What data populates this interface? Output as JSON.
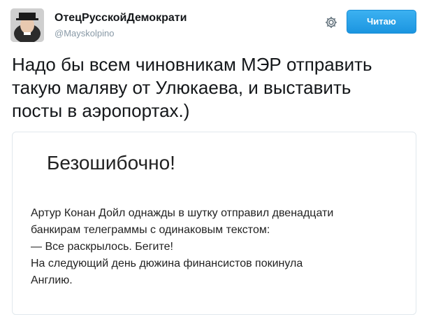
{
  "header": {
    "display_name": "ОтецРусскойДемократи",
    "username": "@Mayskolpino",
    "follow_button_label": "Читаю",
    "settings_icon": "gear-icon",
    "accent_color": "#1b95e0"
  },
  "tweet": {
    "text": "Надо бы всем чиновникам МЭР отправить\nтакую маляву от Улюкаева, и выставить\nпосты в аэропортах.)"
  },
  "card": {
    "title": "Безошибочно!",
    "body": "Артур Конан Дойл однажды в шутку отправил двенадцати\nбанкирам телеграммы с одинаковым текстом:\n— Все раскрылось. Бегите!\nНа следующий день дюжина финансистов покинула\nАнглию."
  }
}
